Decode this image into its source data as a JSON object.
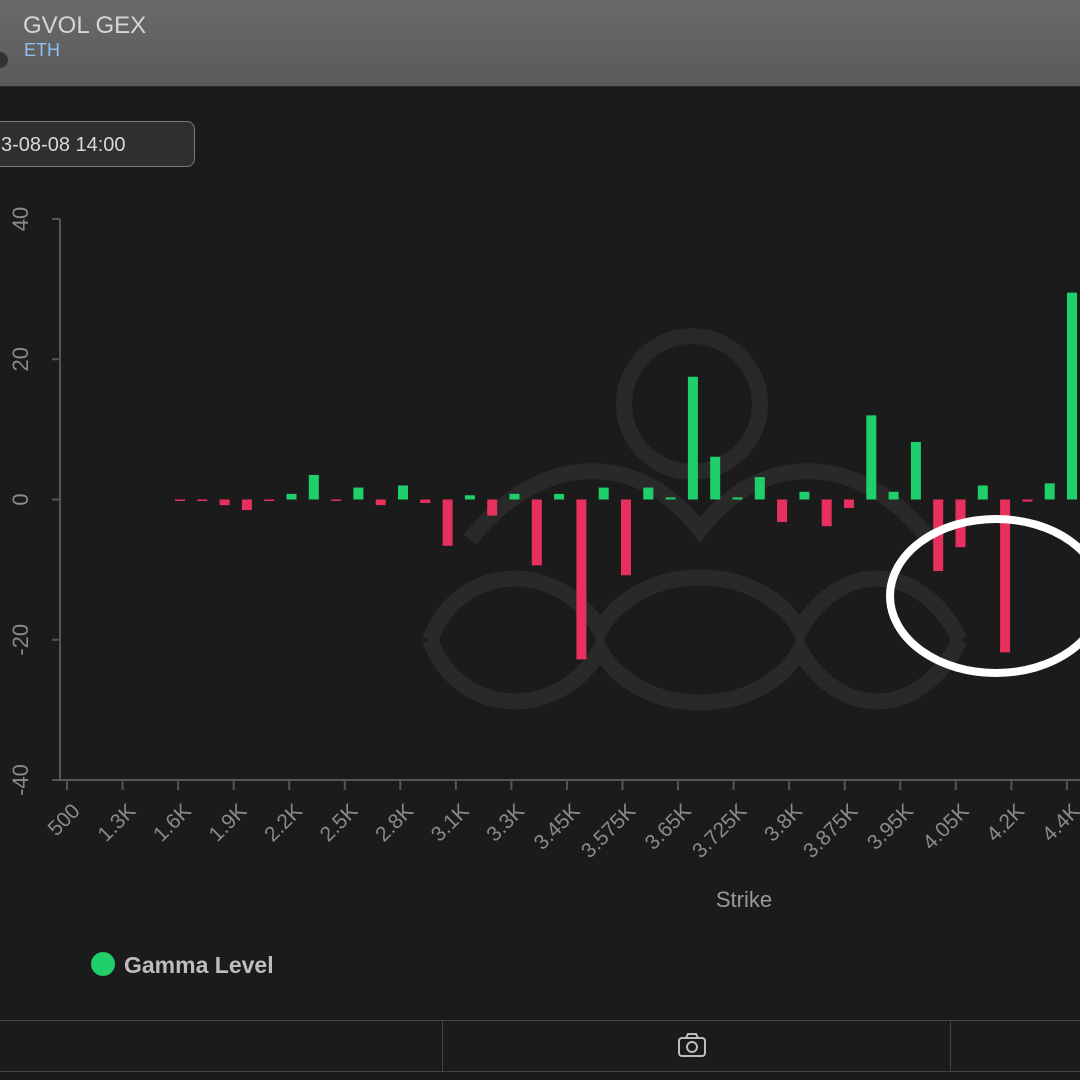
{
  "header": {
    "title": "GVOL GEX",
    "asset": "ETH"
  },
  "date_selector": {
    "value": "3-08-08 14:00"
  },
  "legend": {
    "label": "Gamma Level"
  },
  "colors": {
    "positive": "#1fcf6a",
    "negative": "#e8305f",
    "background": "#1b1b1b",
    "annotation": "#ffffff"
  },
  "footer": {
    "camera_icon": "camera-icon"
  },
  "chart_data": {
    "type": "bar",
    "xlabel": "Strike",
    "ylabel": "",
    "ylim": [
      -40,
      40
    ],
    "yticks": [
      "40",
      "20",
      "0",
      "-20",
      "-40"
    ],
    "x_tick_labels": [
      "500",
      "1.3K",
      "1.6K",
      "1.9K",
      "2.2K",
      "2.5K",
      "2.8K",
      "3.1K",
      "3.3K",
      "3.45K",
      "3.575K",
      "3.65K",
      "3.725K",
      "3.8K",
      "3.875K",
      "3.95K",
      "4.05K",
      "4.2K",
      "4.4K"
    ],
    "legend_position": "bottom-left",
    "grid": false,
    "series": [
      {
        "name": "Gamma Level",
        "values": [
          -0.2,
          -0.2,
          -0.8,
          -1.5,
          -0.2,
          0.8,
          3.5,
          -0.2,
          1.7,
          -0.8,
          2.0,
          -0.5,
          -6.6,
          0.6,
          -2.3,
          0.8,
          -9.4,
          0.8,
          -22.8,
          1.7,
          -10.8,
          1.7,
          0.3,
          17.5,
          6.1,
          0.3,
          3.2,
          -3.2,
          1.1,
          -3.8,
          -1.2,
          12.0,
          1.1,
          8.2,
          -10.2,
          -6.8,
          2.0,
          -21.8,
          -0.3,
          2.3,
          29.5
        ]
      }
    ]
  },
  "annotation": {
    "shape": "ellipse",
    "color": "#ffffff"
  }
}
